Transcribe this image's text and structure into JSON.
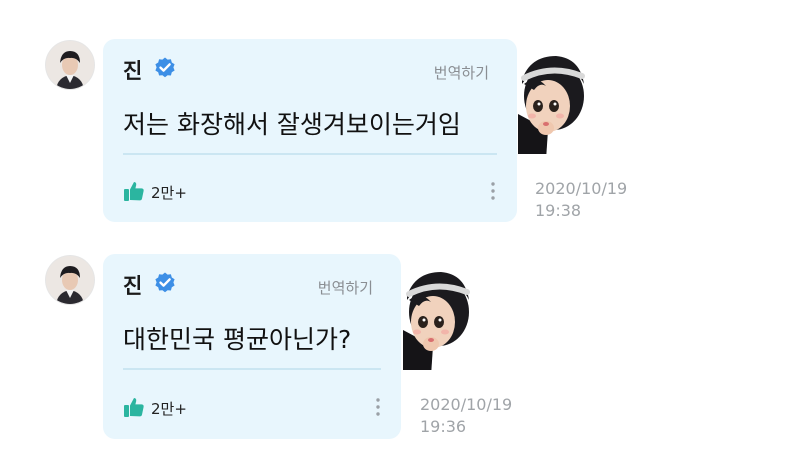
{
  "posts": [
    {
      "author": "진",
      "translate_label": "번역하기",
      "message": "저는 화장해서 잘생겨보이는거임",
      "likes": "2만+",
      "date": "2020/10/19",
      "time": "19:38"
    },
    {
      "author": "진",
      "translate_label": "번역하기",
      "message": "대한민국 평균아닌가?",
      "likes": "2만+",
      "date": "2020/10/19",
      "time": "19:36"
    }
  ],
  "colors": {
    "bubble_bg": "#e8f6fd",
    "verified_badge": "#3d8fe6",
    "like_icon": "#2bb5a0",
    "timestamp": "#a0a4a8"
  },
  "icons": [
    "verified-badge-icon",
    "thumbs-up-icon",
    "more-vertical-icon",
    "chibi-sticker"
  ]
}
